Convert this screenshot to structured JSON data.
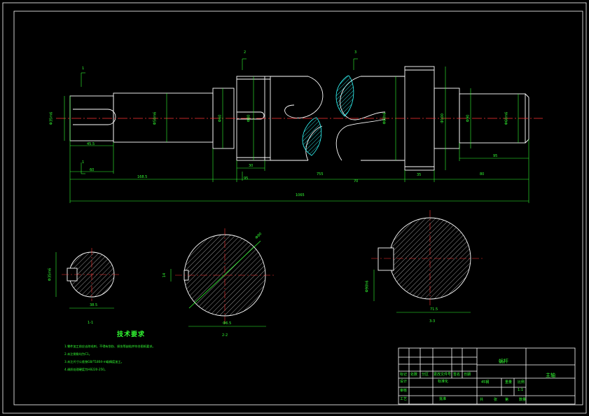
{
  "colors": {
    "background": "#000000",
    "outline": "#ffffff",
    "dimension": "#33ff33",
    "centerline": "#ff3333",
    "hatch": "#33ffff",
    "hatch_section": "#33ffff"
  },
  "main_view": {
    "section_markers": [
      {
        "label": "1"
      },
      {
        "label": "1"
      },
      {
        "label": "2"
      },
      {
        "label": "3"
      }
    ],
    "diameters": {
      "left_journal": "Ф35m6",
      "mid_left": "Ф50m6",
      "collar": "Ф60",
      "bush_left": "Ф80",
      "worm": "Ф80h6",
      "flange": "Ф100",
      "right_shoulder": "Ф90",
      "right_journal": "Ф60m6"
    },
    "dimensions": {
      "key_left": "45.5",
      "len_a": "60",
      "len_b": "168.5",
      "len_c": "30",
      "len_d": "95",
      "len_e": "755",
      "len_f": "70",
      "len_g": "35",
      "len_h": "80",
      "len_i": "95",
      "total": "1065"
    }
  },
  "sections": [
    {
      "label": "1-1",
      "width_dim": "38.5",
      "height_dim": "Ф35m6"
    },
    {
      "label": "2-2",
      "width_dim": "Ф6.5",
      "key_dim": "14",
      "diameter": "Ф80"
    },
    {
      "label": "3-3",
      "width_dim": "71.5",
      "height_dim": "Ф90h6"
    }
  ],
  "notes": {
    "title": "技术要求",
    "lines": [
      "1.零件加工前应去除毛刺，不得有划伤、损伤等缺陷并符合图纸要求。",
      "2.未注倒角均为C1。",
      "3.未注尺寸公差按GB/T1804-m级精度加工。",
      "4.调质处理硬度为HB220-250。"
    ]
  },
  "title_block": {
    "drawing_name": "蜗杆",
    "part_name": "主轴",
    "material": "45钢",
    "scale_label": "比例",
    "scale": "1:1",
    "weight_label": "重量",
    "qty_label": "数量",
    "designer_label": "设计",
    "checker_label": "审核",
    "process_label": "工艺",
    "approve_label": "批准",
    "sheet_total": "共",
    "sheet_no": "张",
    "sheet_of": "第",
    "date_label": "日期",
    "sign_label": "签名",
    "update_label": "更改文件号",
    "mark_label": "标记",
    "zone_label": "分区",
    "count_label": "处数",
    "std_label": "标准化"
  }
}
